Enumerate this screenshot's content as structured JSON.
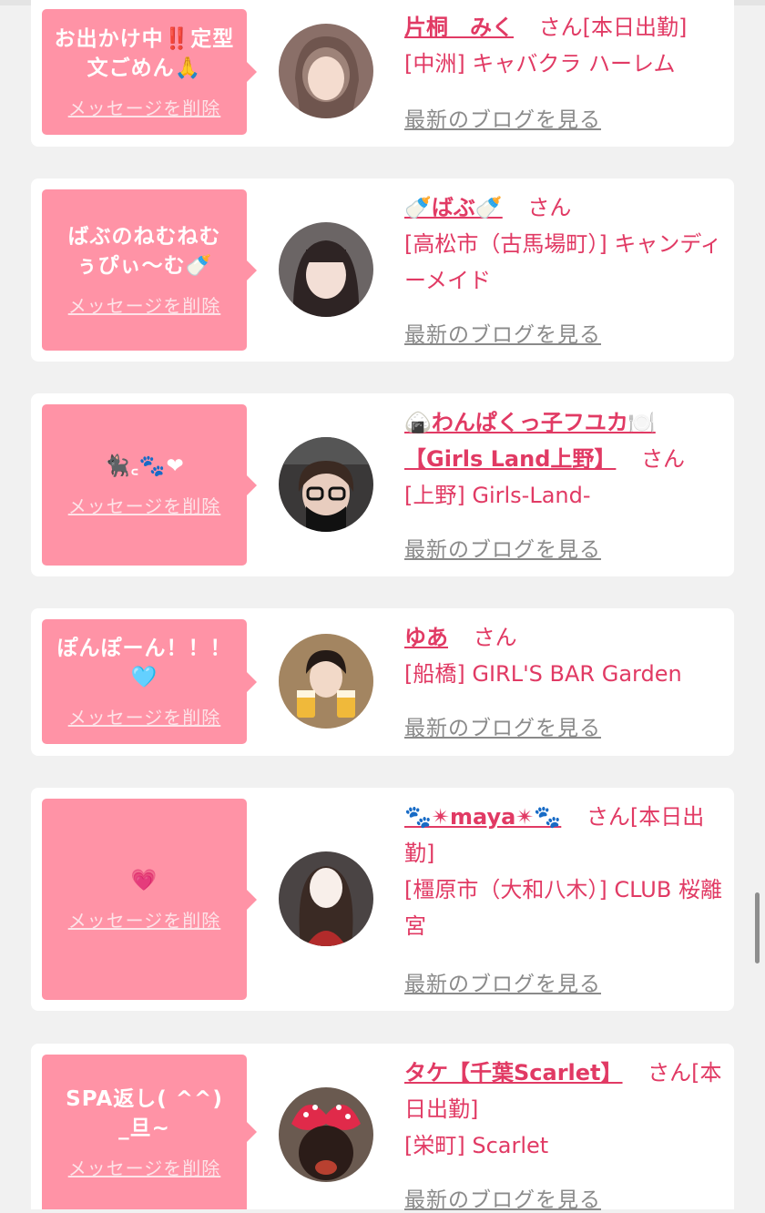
{
  "page": {
    "background": "#f1f1f1",
    "accent": "#e13a64",
    "bubble_color": "#ff93a6"
  },
  "cards": [
    {
      "message": "お出かけ中‼️定型文ごめん🙏",
      "delete_label": "メッセージを削除",
      "name": "片桐　みく",
      "suffix": "さん[本日出勤]",
      "shop": "[中洲] キャバクラ ハーレム",
      "blog_label": "最新のブログを見る",
      "avatar_icon": "avatar-photo"
    },
    {
      "message": "ばぶのねむねむぅぴぃ〜む🍼",
      "delete_label": "メッセージを削除",
      "name": "🍼ばぶ🍼",
      "suffix": "さん",
      "shop": "[高松市（古馬場町）] キャンディーメイド",
      "blog_label": "最新のブログを見る",
      "avatar_icon": "avatar-photo"
    },
    {
      "message": "🐈‍⬛꜀🐾❤",
      "delete_label": "メッセージを削除",
      "name": "🍙わんぱくっ子フユカ🍽️【Girls Land上野】",
      "suffix": "さん",
      "shop": "[上野] Girls-Land-",
      "blog_label": "最新のブログを見る",
      "avatar_icon": "avatar-photo"
    },
    {
      "message": "ぽんぽーん！！！🩵",
      "delete_label": "メッセージを削除",
      "name": "ゆあ",
      "suffix": "さん",
      "shop": "[船橋] GIRL'S BAR Garden",
      "blog_label": "最新のブログを見る",
      "avatar_icon": "avatar-photo"
    },
    {
      "message": "💗",
      "delete_label": "メッセージを削除",
      "name": "🐾✴maya✴🐾",
      "suffix": "さん[本日出勤]",
      "shop": "[橿原市（大和八木）] CLUB 桜離宮",
      "blog_label": "最新のブログを見る",
      "avatar_icon": "avatar-photo"
    },
    {
      "message": "SPA返し( ^^) _旦~",
      "delete_label": "メッセージを削除",
      "name": "タケ【千葉Scarlet】",
      "suffix": "さん[本日出勤]",
      "shop": "[栄町] Scarlet",
      "blog_label": "最新のブログを見る",
      "avatar_icon": "avatar-photo"
    }
  ]
}
